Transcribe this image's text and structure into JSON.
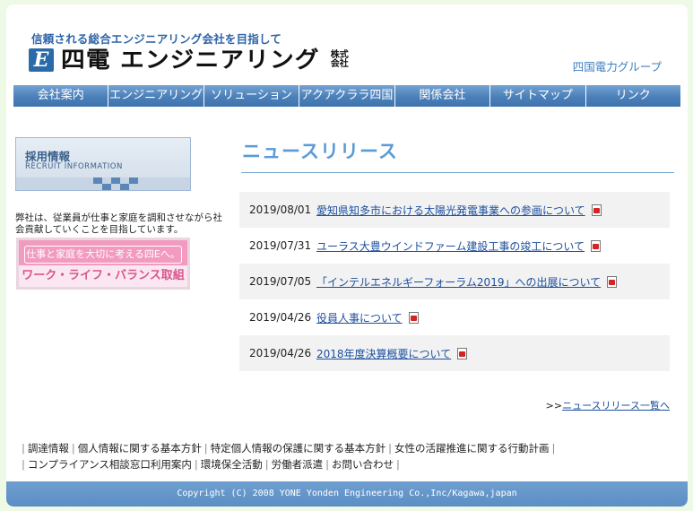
{
  "header": {
    "tagline": "信頼される総合エンジニアリング会社を目指して",
    "logo_mark": "E",
    "logo_text": "四電 エンジニアリング",
    "logo_kabushiki": "株式会社",
    "group_link": "四国電力グループ"
  },
  "nav": {
    "items": [
      {
        "label": "会社案内"
      },
      {
        "label": "エンジニアリング"
      },
      {
        "label": "ソリューション"
      },
      {
        "label": "アクアクララ四国"
      },
      {
        "label": "関係会社"
      },
      {
        "label": "サイトマップ"
      },
      {
        "label": "リンク"
      }
    ]
  },
  "sidebar": {
    "recruit_title": "採用情報",
    "recruit_subtitle": "RECRUIT INFORMATION",
    "intro_text": "弊社は、従業員が仕事と家庭を調和させながら社会貢献していくことを目指しています。",
    "wlb_top": "仕事と家庭を大切に考える四Eへ。",
    "wlb_bottom": "ワーク・ライフ・バランス取組"
  },
  "news": {
    "title": "ニュースリリース",
    "items": [
      {
        "date": "2019/08/01",
        "title": "愛知県知多市における太陽光発電事業への参画について"
      },
      {
        "date": "2019/07/31",
        "title": "ユーラス大豊ウインドファーム建設工事の竣工について"
      },
      {
        "date": "2019/07/05",
        "title": "「インテルエネルギーフォーラム2019」への出展について"
      },
      {
        "date": "2019/04/26",
        "title": "役員人事について"
      },
      {
        "date": "2019/04/26",
        "title": "2018年度決算概要について"
      }
    ],
    "all_prefix": ">>",
    "all_link": "ニュースリリース一覧へ"
  },
  "footer": {
    "links_row1": [
      "調達情報",
      "個人情報に関する基本方針",
      "特定個人情報の保護に関する基本方針",
      "女性の活躍推進に関する行動計画"
    ],
    "links_row2": [
      "コンプライアンス相談窓口利用案内",
      "環境保全活動",
      "労働者派遣",
      "お問い合わせ"
    ],
    "separator": "|",
    "copyright": "Copyright (C) 2008 YONE Yonden Engineering Co.,Inc/Kagawa,japan"
  },
  "colors": {
    "nav": "#4b7fb9",
    "accent": "#5b9bd6",
    "link": "#1b4f9e",
    "background": "#eef9e6",
    "wlb_pink": "#f29ac0"
  }
}
